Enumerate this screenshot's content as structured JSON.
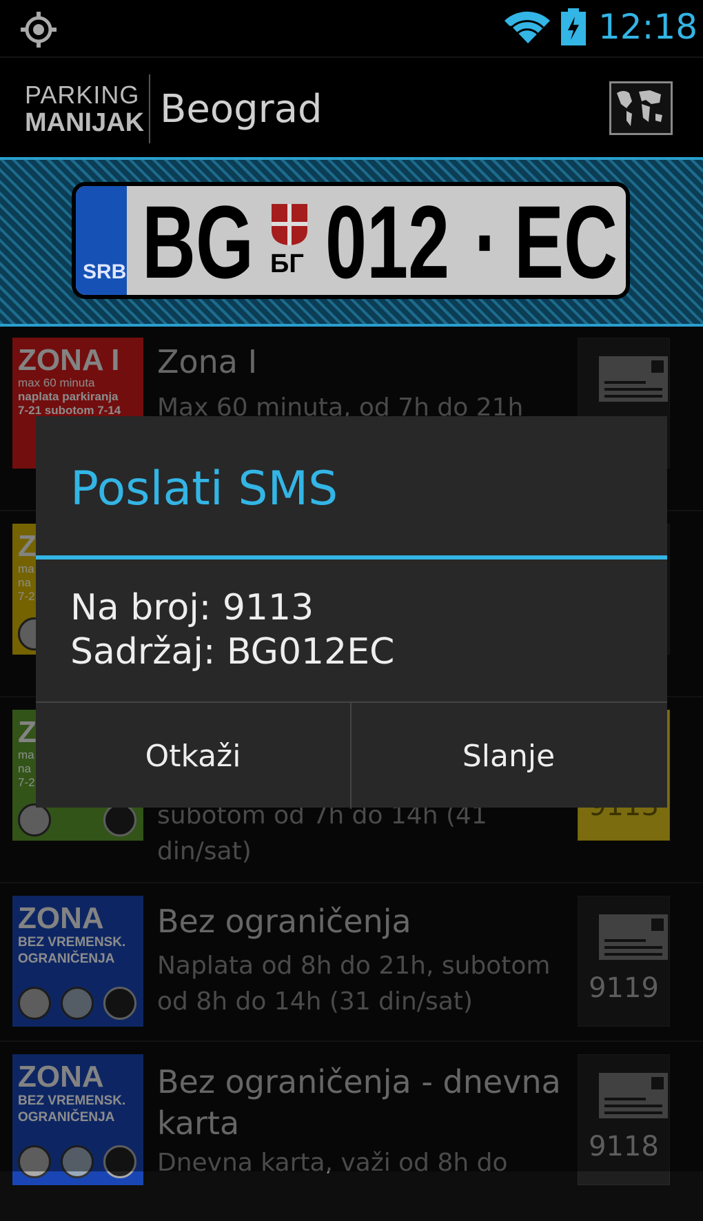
{
  "status_bar": {
    "time": "12:18",
    "icons": [
      "gps-icon",
      "wifi-icon",
      "battery-charging-icon"
    ]
  },
  "action_bar": {
    "logo_line1": "PARKING",
    "logo_line2": "MANIJAK",
    "city": "Beograd",
    "map_icon": "world-map-icon"
  },
  "plate": {
    "country": "SRB",
    "city_code": "BG",
    "city_code_cyrillic": "БГ",
    "number": "012",
    "sep": "·",
    "suffix": "EC"
  },
  "zones": [
    {
      "badge_title": "ZONA  I",
      "badge_lines": [
        "max 60 minuta",
        "naplata parkiranja",
        "7-21 subotom 7-14"
      ],
      "title": "Zona I",
      "subtitle": "Max 60 minuta, od 7h do 21h",
      "sms_number": "",
      "color": "#d11a1a"
    },
    {
      "badge_title": "Z",
      "badge_lines": [
        "ma",
        "na",
        "7-2"
      ],
      "title": "",
      "subtitle": "",
      "sms_number": "",
      "color": "#d4b400"
    },
    {
      "badge_title": "Z",
      "badge_lines": [
        "ma",
        "na",
        "7-2"
      ],
      "title": "",
      "subtitle": "subotom od 7h do 14h (41 din/sat)",
      "sms_number": "9113",
      "color": "#5b9a2c"
    },
    {
      "badge_title": "ZONA",
      "badge_lines": [
        "BEZ VREMENSK.",
        "OGRANIČENJA"
      ],
      "title": "Bez ograničenja",
      "subtitle": "Naplata od 8h do 21h, subotom od 8h do 14h (31 din/sat)",
      "sms_number": "9119",
      "color": "#1946b4"
    },
    {
      "badge_title": "ZONA",
      "badge_lines": [
        "BEZ VREMENSK.",
        "OGRANIČENJA"
      ],
      "title": "Bez ograničenja - dnevna karta",
      "subtitle": "Dnevna karta, važi od 8h do",
      "sms_number": "9118",
      "color": "#1946b4"
    }
  ],
  "dialog": {
    "title": "Poslati SMS",
    "number_line": "Na broj: 9113",
    "content_line": "Sadržaj: BG012EC",
    "cancel_label": "Otkaži",
    "send_label": "Slanje",
    "accent": "#33b5e5"
  }
}
